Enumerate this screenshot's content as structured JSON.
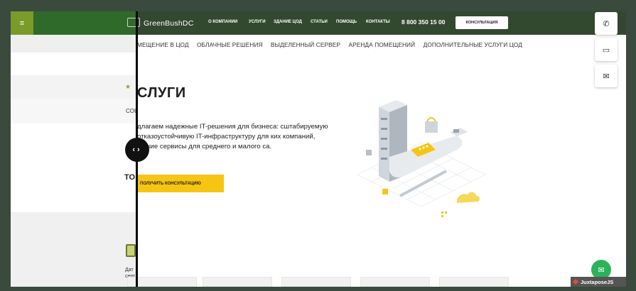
{
  "after": {
    "logo": "GreenBushDC",
    "nav": [
      "О КОМПАНИИ",
      "УСЛУГИ",
      "ЗДАНИЕ ЦОД",
      "СТАТЬИ",
      "ПОМОЩЬ",
      "КОНТАКТЫ"
    ],
    "phone": "8 800 350 15 00",
    "consult_button": "КОНСУЛЬТАЦИЯ",
    "subnav": [
      "МЕЩЕНИЕ В ЦОД",
      "ОБЛАЧНЫЕ РЕШЕНИЯ",
      "ВЫДЕЛЕННЫЙ СЕРВЕР",
      "АРЕНДА ПОМЕЩЕНИЙ",
      "ДОПОЛНИТЕЛЬНЫЕ УСЛУГИ ЦОД"
    ],
    "hero_title": "СЛУГИ",
    "hero_text": "длагаем надежные IT-решения для бизнеса: сштабируемую отказоустойчивую IT-инфраструктуру для ких компаний, гибкие сервисы для среднего и малого са.",
    "cta": "ПОЛУЧИТЬ КОНСУЛЬТАЦИЮ"
  },
  "before": {
    "menu_icon": "≡",
    "cou_text": "COU",
    "to_text": "ТО",
    "dat_text": "Дат серт"
  },
  "side_buttons": [
    "phone-icon",
    "chat-icon",
    "mail-icon"
  ],
  "watermark": "JuxtaposeJS",
  "colors": {
    "header_green": "#33492f",
    "accent_yellow": "#f6c514",
    "fab_green": "#2cb35a"
  }
}
